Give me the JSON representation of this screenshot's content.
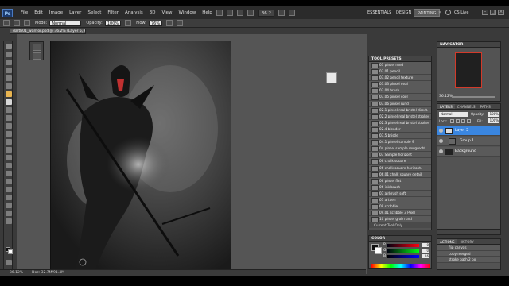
{
  "menubar": {
    "logo": "Ps",
    "items": [
      "File",
      "Edit",
      "Image",
      "Layer",
      "Select",
      "Filter",
      "Analysis",
      "3D",
      "View",
      "Window",
      "Help"
    ],
    "zoom": "36.2",
    "workspaces": [
      "ESSENTIALS",
      "DESIGN",
      "PAINTING"
    ],
    "active_workspace": "PAINTING",
    "cs_live": "CS Live"
  },
  "options": {
    "mode_label": "Mode:",
    "mode_value": "Normal",
    "opacity_label": "Opacity:",
    "opacity_value": "100%",
    "flow_label": "Flow:",
    "flow_value": "76%"
  },
  "document": {
    "tab_title": "darth01_warrior.psd @ 36.2% (Layer 5, RGB/8) *",
    "status_zoom": "36.12%",
    "status_doc": "Doc: 32.7M/91.4M"
  },
  "tool_presets": {
    "title": "TOOL PRESETS",
    "items": [
      "03 pinsel rund",
      "03.01 pencil",
      "03.02 pencil texture",
      "03.03 pinsel oval",
      "03.04 brush",
      "03.05 pinsel cool",
      "03.06 pinsel rund",
      "02.1 pinsel real bristel direct.",
      "02.2 pinsel real bristel strokes",
      "02.3 pinsel real bristel strokes",
      "02.4 blender",
      "03.5 bristle",
      "04.1 pinsel sample 9",
      "04 pinsel sample rowgrocht",
      "03 Sample horizont",
      "06 chalk square",
      "06 chalk square horizont.",
      "06.01 chalk square detail",
      "06 pinsel flat",
      "06 ink brush",
      "07 airbrush soft",
      "07 artpen",
      "09 scribble",
      "09.01 scribble 3 Pixel",
      "10 pinsel grob rund"
    ],
    "current_only": "Current Tool Only"
  },
  "color_panel": {
    "title": "COLOR",
    "labels": [
      "R",
      "G",
      "B"
    ],
    "values": [
      "0",
      "0",
      "16"
    ]
  },
  "navigator": {
    "title": "NAVIGATOR",
    "zoom": "36.12%"
  },
  "layers": {
    "tabs": [
      "LAYERS",
      "CHANNELS",
      "PATHS"
    ],
    "blend_mode": "Normal",
    "opacity_label": "Opacity:",
    "opacity_value": "100%",
    "lock_label": "Lock:",
    "fill_label": "Fill:",
    "fill_value": "100%",
    "items": [
      {
        "name": "Layer 5",
        "selected": true
      },
      {
        "name": "Group 1",
        "selected": false
      },
      {
        "name": "Background",
        "selected": false
      }
    ]
  },
  "actions": {
    "tabs": [
      "ACTIONS",
      "HISTORY"
    ],
    "items": [
      "flip canvas",
      "copy merged",
      "stroke path 2 px"
    ]
  }
}
